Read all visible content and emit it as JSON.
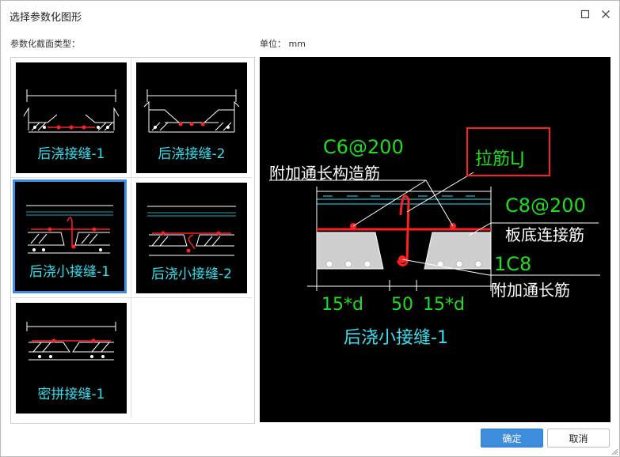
{
  "window": {
    "title": "选择参数化图形"
  },
  "labels": {
    "section_type": "参数化截面类型：",
    "unit": "单位：  mm"
  },
  "thumbnails": [
    {
      "label": "后浇接缝-1"
    },
    {
      "label": "后浇接缝-2"
    },
    {
      "label": "后浇小接缝-1"
    },
    {
      "label": "后浇小接缝-2"
    },
    {
      "label": "密拼接缝-1"
    }
  ],
  "preview": {
    "title": "后浇小接缝-1",
    "annotations": {
      "c6_200": "C6@200",
      "add_long_construct": "附加通长构造筋",
      "tie_bar": "拉筋LJ",
      "c8_200": "C8@200",
      "bottom_connect": "板底连接筋",
      "one_c8": "1C8",
      "add_long": "附加通长筋",
      "dim_left": "15*d",
      "dim_mid": "50",
      "dim_right": "15*d"
    }
  },
  "buttons": {
    "ok": "确定",
    "cancel": "取消"
  },
  "colors": {
    "accent": "#3e8ddd",
    "cad_cyan": "#33e0f0",
    "cad_green": "#1fdd1f",
    "cad_red": "#ff2020"
  }
}
